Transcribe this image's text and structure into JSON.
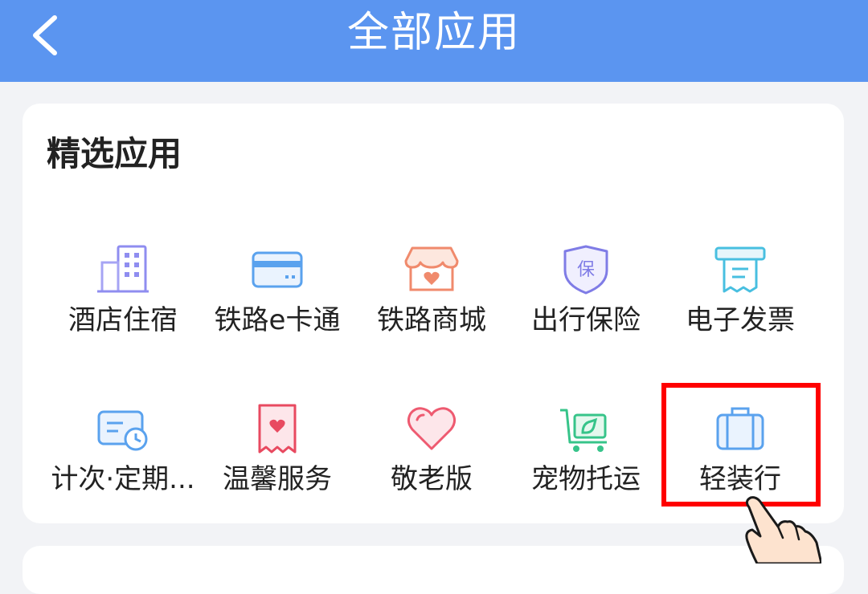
{
  "header": {
    "title": "全部应用",
    "back_icon": "chevron-left-icon",
    "bg_color": "#5b95f0"
  },
  "section": {
    "title": "精选应用"
  },
  "apps": [
    {
      "label": "酒店住宿",
      "icon": "building-icon"
    },
    {
      "label": "铁路e卡通",
      "icon": "card-icon"
    },
    {
      "label": "铁路商城",
      "icon": "shop-icon"
    },
    {
      "label": "出行保险",
      "icon": "shield-icon"
    },
    {
      "label": "电子发票",
      "icon": "invoice-icon"
    },
    {
      "label": "计次·定期...",
      "icon": "ticket-clock-icon"
    },
    {
      "label": "温馨服务",
      "icon": "heart-ribbon-icon"
    },
    {
      "label": "敬老版",
      "icon": "heart-icon"
    },
    {
      "label": "宠物托运",
      "icon": "pet-cart-icon"
    },
    {
      "label": "轻装行",
      "icon": "suitcase-icon"
    }
  ],
  "highlight": {
    "target": "轻装行",
    "color": "#ff0000"
  },
  "pointer": {
    "icon": "pointing-hand-icon"
  }
}
